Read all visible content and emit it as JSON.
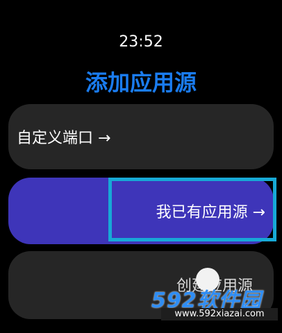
{
  "status": {
    "time": "23:52"
  },
  "header": {
    "title": "添加应用源"
  },
  "options": {
    "custom_port": "自定义端口 →",
    "existing_source": "我已有应用源 →",
    "create_source": "创建应用源"
  },
  "watermark": {
    "logo": "592软件园",
    "url": "www.592xiazai.com"
  },
  "colors": {
    "accent": "#1a7cf0",
    "selected_item": "#3e35b9",
    "highlight_border": "#17a9d6",
    "item_background": "#262626"
  }
}
